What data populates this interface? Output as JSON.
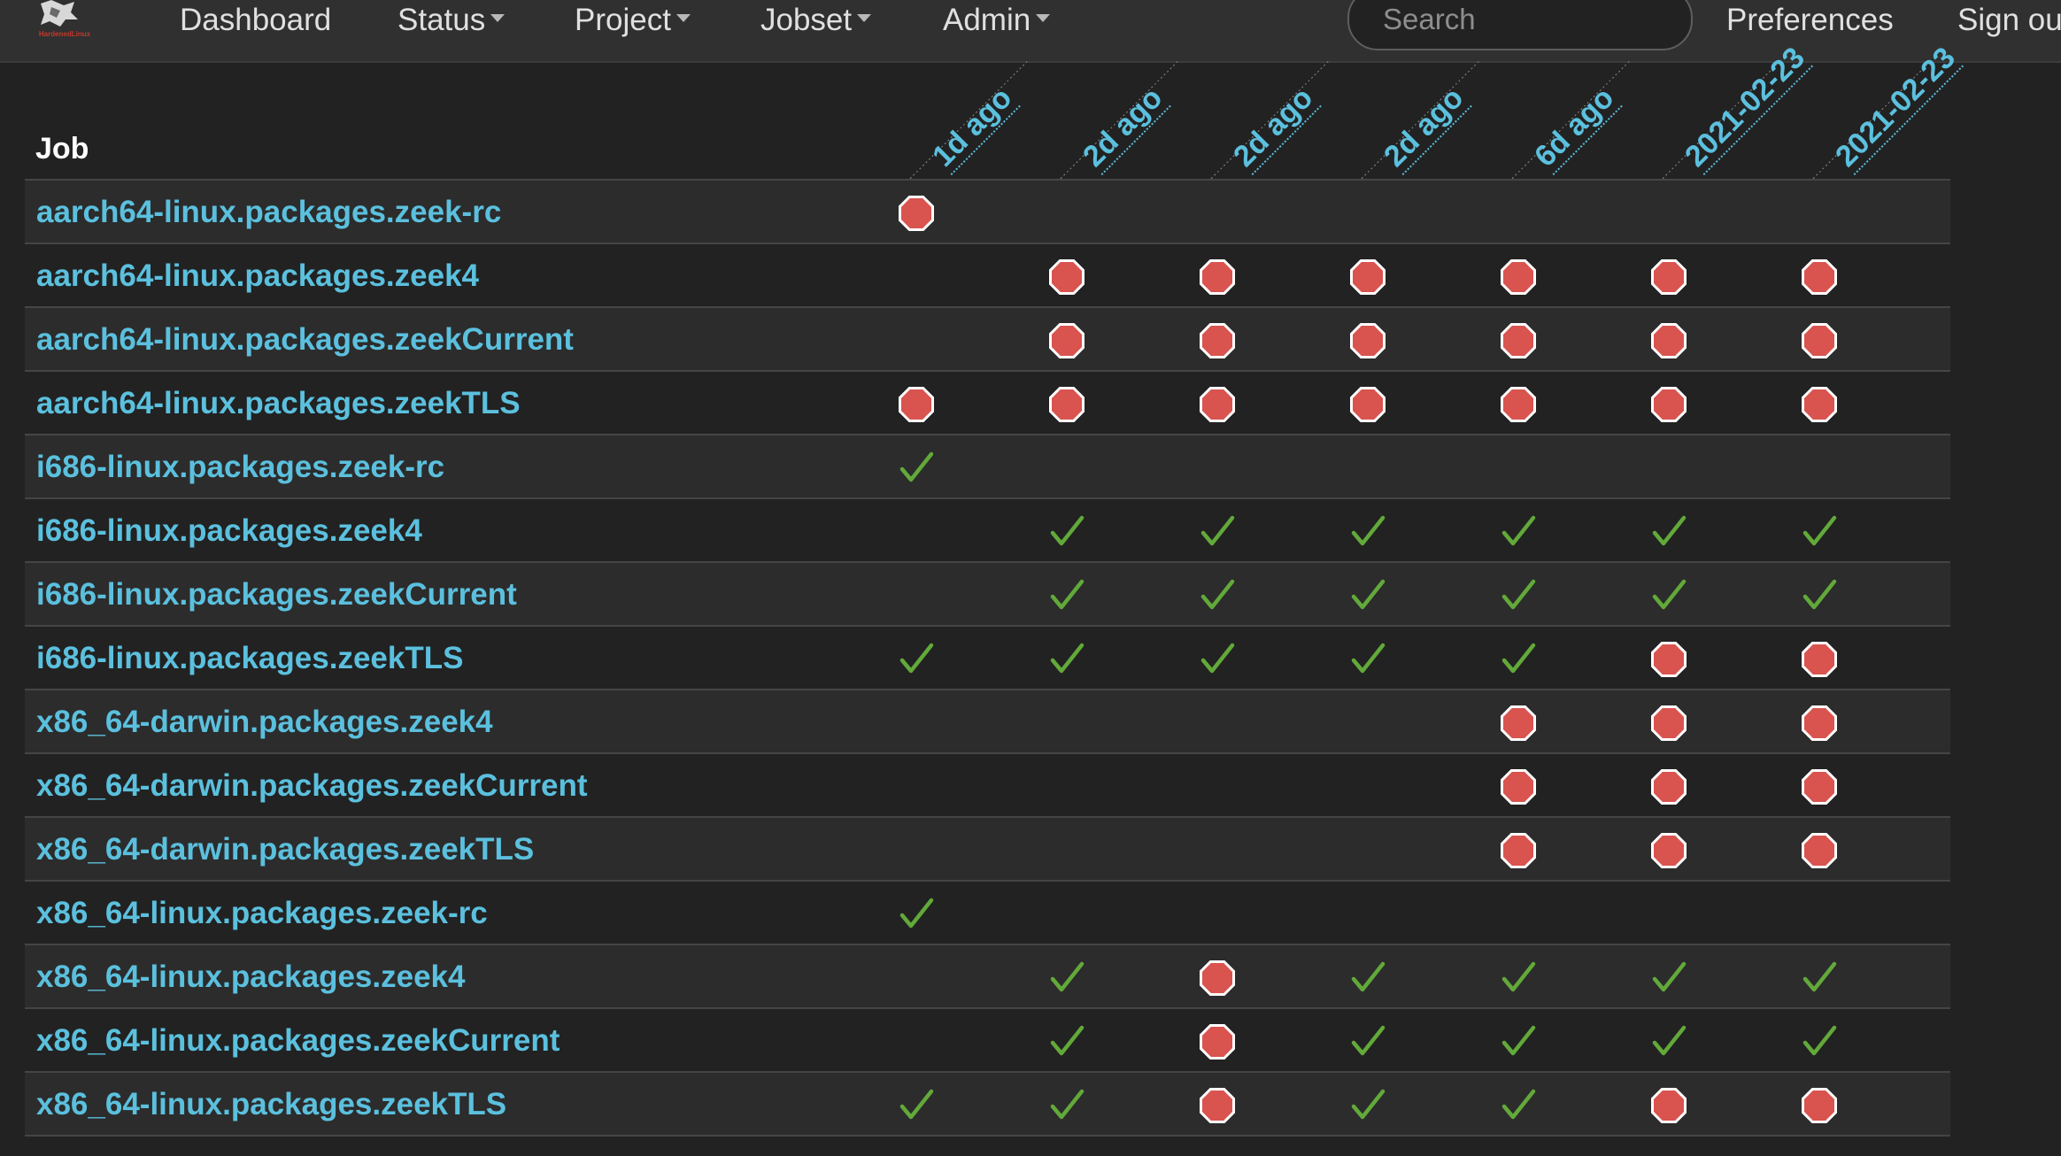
{
  "nav": {
    "logo_text": "HardenedLinux",
    "items": [
      {
        "label": "Dashboard",
        "dropdown": false
      },
      {
        "label": "Status",
        "dropdown": true
      },
      {
        "label": "Project",
        "dropdown": true
      },
      {
        "label": "Jobset",
        "dropdown": true
      },
      {
        "label": "Admin",
        "dropdown": true
      }
    ],
    "search_placeholder": "Search",
    "preferences": "Preferences",
    "sign_out": "Sign ou"
  },
  "table": {
    "job_header": "Job",
    "columns": [
      "1d ago",
      "2d ago",
      "2d ago",
      "2d ago",
      "6d ago",
      "2021-02-23",
      "2021-02-23"
    ],
    "rows": [
      {
        "job": "aarch64-linux.packages.zeek-rc",
        "status": [
          "fail",
          null,
          null,
          null,
          null,
          null,
          null
        ]
      },
      {
        "job": "aarch64-linux.packages.zeek4",
        "status": [
          null,
          "fail",
          "fail",
          "fail",
          "fail",
          "fail",
          "fail"
        ]
      },
      {
        "job": "aarch64-linux.packages.zeekCurrent",
        "status": [
          null,
          "fail",
          "fail",
          "fail",
          "fail",
          "fail",
          "fail"
        ]
      },
      {
        "job": "aarch64-linux.packages.zeekTLS",
        "status": [
          "fail",
          "fail",
          "fail",
          "fail",
          "fail",
          "fail",
          "fail"
        ]
      },
      {
        "job": "i686-linux.packages.zeek-rc",
        "status": [
          "success",
          null,
          null,
          null,
          null,
          null,
          null
        ]
      },
      {
        "job": "i686-linux.packages.zeek4",
        "status": [
          null,
          "success",
          "success",
          "success",
          "success",
          "success",
          "success"
        ]
      },
      {
        "job": "i686-linux.packages.zeekCurrent",
        "status": [
          null,
          "success",
          "success",
          "success",
          "success",
          "success",
          "success"
        ]
      },
      {
        "job": "i686-linux.packages.zeekTLS",
        "status": [
          "success",
          "success",
          "success",
          "success",
          "success",
          "fail",
          "fail"
        ]
      },
      {
        "job": "x86_64-darwin.packages.zeek4",
        "status": [
          null,
          null,
          null,
          null,
          "fail",
          "fail",
          "fail"
        ]
      },
      {
        "job": "x86_64-darwin.packages.zeekCurrent",
        "status": [
          null,
          null,
          null,
          null,
          "fail",
          "fail",
          "fail"
        ]
      },
      {
        "job": "x86_64-darwin.packages.zeekTLS",
        "status": [
          null,
          null,
          null,
          null,
          "fail",
          "fail",
          "fail"
        ]
      },
      {
        "job": "x86_64-linux.packages.zeek-rc",
        "status": [
          "success",
          null,
          null,
          null,
          null,
          null,
          null
        ]
      },
      {
        "job": "x86_64-linux.packages.zeek4",
        "status": [
          null,
          "success",
          "fail",
          "success",
          "success",
          "success",
          "success"
        ]
      },
      {
        "job": "x86_64-linux.packages.zeekCurrent",
        "status": [
          null,
          "success",
          "fail",
          "success",
          "success",
          "success",
          "success"
        ]
      },
      {
        "job": "x86_64-linux.packages.zeekTLS",
        "status": [
          "success",
          "success",
          "fail",
          "success",
          "success",
          "fail",
          "fail"
        ]
      }
    ]
  },
  "colors": {
    "link": "#5bc0de",
    "success": "#62a93a",
    "fail": "#d9534f",
    "background": "#222222",
    "navbar": "#303030"
  },
  "icons": {
    "success": "checkmark-icon",
    "fail": "stop-octagon-icon",
    "caret": "caret-down-icon"
  }
}
